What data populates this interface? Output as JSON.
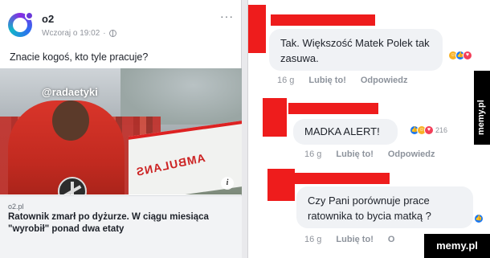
{
  "post": {
    "page_name": "o2",
    "timestamp": "Wczoraj o 19:02",
    "text": "Znacie kogoś, kto tyle pracuje?",
    "photo_tag": "@radaetyki",
    "photo_sign": "AMBULANS",
    "link_domain": "o2.pl",
    "link_title": "Ratownik zmarł po dyżurze. W ciągu miesiąca \"wyrobił\" ponad dwa etaty"
  },
  "comments": [
    {
      "text": "Tak. Większość Matek Polek tak zasuwa.",
      "time": "16 g",
      "like": "Lubię to!",
      "reply": "Odpowiedz",
      "reactions": [
        "haha-icon",
        "like-icon",
        "love-icon"
      ]
    },
    {
      "text": "MADKA ALERT!",
      "time": "16 g",
      "like": "Lubię to!",
      "reply": "Odpowiedz",
      "reactions": [
        "like-icon",
        "haha-icon",
        "love-icon"
      ],
      "reaction_count": "216"
    },
    {
      "text": "Czy Pani porównuje prace ratownika to bycia matką ?",
      "time": "16 g",
      "like": "Lubię to!",
      "reply": "O",
      "reactions": [
        "like-icon"
      ]
    }
  ],
  "watermark": {
    "side": "memy.pl",
    "corner": "memy.pl"
  },
  "colors": {
    "redaction": "#ee1c1c",
    "fb_blue": "#1877f2",
    "bubble": "#f0f2f5"
  }
}
